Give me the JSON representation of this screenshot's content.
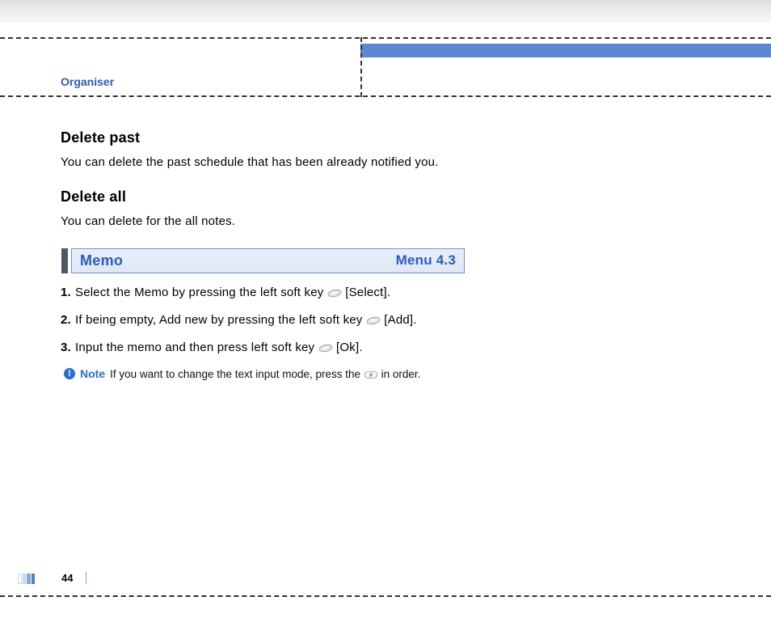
{
  "header": {
    "breadcrumb": "Organiser"
  },
  "sections": {
    "delete_past": {
      "title": "Delete past",
      "body": "You can delete the past schedule that has been already notified you."
    },
    "delete_all": {
      "title": "Delete all",
      "body": "You can delete for the all notes."
    }
  },
  "menu": {
    "title": "Memo",
    "number": "Menu 4.3"
  },
  "steps": [
    {
      "pre": "Select the Memo by pressing the left soft key ",
      "post": " [Select]."
    },
    {
      "pre": "If being empty, Add new by pressing the left soft key ",
      "post": " [Add]."
    },
    {
      "pre": "Input the memo and then press left soft key ",
      "post": " [Ok]."
    }
  ],
  "note": {
    "label": "Note",
    "text_pre": "If you want to change the text input mode, press the ",
    "text_post": " in order."
  },
  "footer": {
    "page": "44"
  }
}
